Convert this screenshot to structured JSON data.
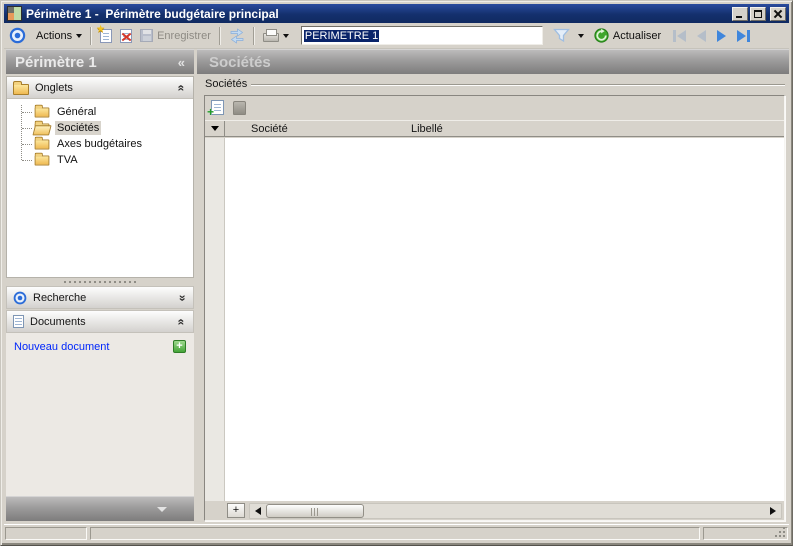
{
  "window": {
    "title": "Périmètre 1 -  Périmètre budgétaire principal"
  },
  "toolbar": {
    "actions_label": "Actions",
    "save_label": "Enregistrer",
    "perimeter_value": "PERIMETRE 1",
    "refresh_label": "Actualiser"
  },
  "sidebar": {
    "title": "Périmètre 1",
    "collapse_glyph": "«",
    "sections": {
      "onglets": {
        "label": "Onglets",
        "chevron": "«"
      },
      "recherche": {
        "label": "Recherche",
        "chevron": "«"
      },
      "documents": {
        "label": "Documents",
        "chevron": "«"
      }
    },
    "tree": [
      {
        "label": "Général"
      },
      {
        "label": "Sociétés",
        "selected": true
      },
      {
        "label": "Axes budgétaires"
      },
      {
        "label": "TVA"
      }
    ],
    "documents_panel": {
      "new_document_label": "Nouveau document",
      "plus_glyph": "+"
    }
  },
  "main": {
    "title": "Sociétés",
    "group_label": "Sociétés",
    "grid": {
      "columns": [
        "Société",
        "Libellé"
      ],
      "rows": [],
      "add_row_glyph": "+"
    }
  },
  "icons": {
    "app": "colored-squares",
    "actions": "bullseye",
    "new": "page-with-star",
    "delete": "page-with-red-x",
    "save": "floppy",
    "sync": "double-blue-arrows",
    "print": "printer",
    "filter": "funnel",
    "refresh": "green-circle-arrow",
    "folder": "yellow-folder",
    "document": "lined-page",
    "add_row": "page-green-plus",
    "delete_row": "eraser"
  },
  "colors": {
    "titlebar": "#14306D",
    "selection": "#0A246A",
    "link": "#0026FB",
    "accent_blue": "#2B6CD8",
    "accent_green": "#35A11F",
    "chrome": "#D6D2CA"
  }
}
